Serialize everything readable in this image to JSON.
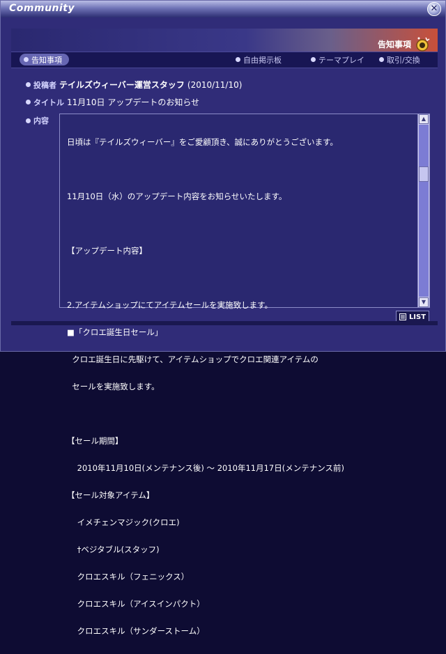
{
  "window": {
    "title": "Community"
  },
  "header": {
    "notice_badge": "告知事項"
  },
  "tabs": [
    {
      "label": "告知事項",
      "active": true
    },
    {
      "label": "自由掲示板",
      "active": false
    },
    {
      "label": "テーマプレイ",
      "active": false
    },
    {
      "label": "取引/交換",
      "active": false
    }
  ],
  "post": {
    "author_label": "投稿者",
    "author": "テイルズウィーバー運営スタッフ",
    "date": "(2010/11/10)",
    "title_label": "タイトル",
    "title": "11月10日 アップデートのお知らせ",
    "content_label": "内容",
    "content_lines": [
      "日頃は『テイルズウィーバー』をご愛顧頂き、誠にありがとうございます。",
      "",
      "11月10日（水）のアップデート内容をお知らせいたします。",
      "",
      "【アップデート内容】",
      "",
      "2.アイテムショップにてアイテムセールを実施致します。",
      "■「クロエ誕生日セール」",
      "  クロエ誕生日に先駆けて、アイテムショップでクロエ関連アイテムの",
      "  セールを実施致します。",
      "",
      "【セール期間】",
      "    2010年11月10日(メンテナンス後) 〜 2010年11月17日(メンテナンス前)",
      "【セール対象アイテム】",
      "    イメチェンマジック(クロエ)",
      "    †ベジタブル(スタッフ)",
      "    クロエスキル（フェニックス）",
      "    クロエスキル（アイスインパクト）",
      "    クロエスキル（サンダーストーム）"
    ]
  },
  "buttons": {
    "list": "LIST"
  },
  "colors": {
    "accent": "#c9503a",
    "panel": "#302c78"
  }
}
